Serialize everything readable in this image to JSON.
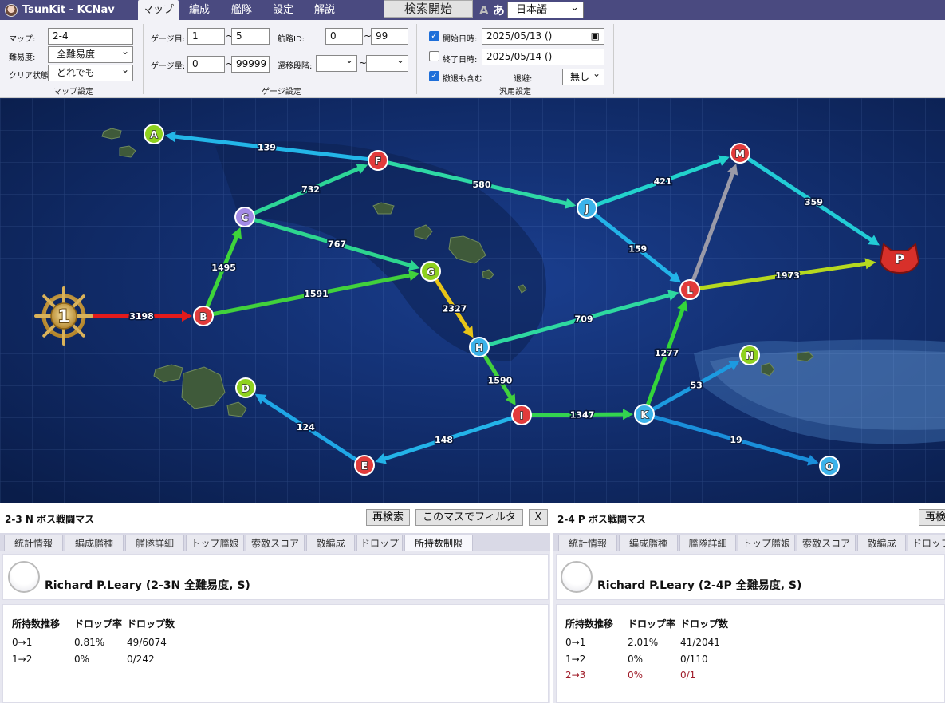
{
  "app": {
    "title": "TsunKit - KCNav"
  },
  "tabs": [
    "マップ",
    "編成",
    "艦隊",
    "設定",
    "解説"
  ],
  "header": {
    "search_button": "検索開始",
    "font_toggle_a": "A",
    "font_toggle_b": "あ",
    "language": "日本語"
  },
  "filters": {
    "map_label": "マップ:",
    "map_value": "2-4",
    "difficulty_label": "難易度:",
    "difficulty_value": "全難易度",
    "clear_label": "クリア状態:",
    "clear_value": "どれでも",
    "map_section": "マップ設定",
    "gauge_no_label": "ゲージ目:",
    "gauge_no_min": "1",
    "gauge_no_max": "5",
    "gauge_amt_label": "ゲージ量:",
    "gauge_amt_min": "0",
    "gauge_amt_max": "99999",
    "route_id_label": "航路ID:",
    "route_id_min": "0",
    "route_id_max": "99",
    "transition_label": "遷移段階:",
    "transition_min": "",
    "transition_max": "",
    "tilde": "~",
    "gauge_section": "ゲージ設定",
    "start_date_label": "開始日時:",
    "start_date_value": "2025/05/13 ()",
    "start_checked": true,
    "end_date_label": "終了日時:",
    "end_date_value": "2025/05/14 ()",
    "end_checked": false,
    "retreat_label": "撤退も含む",
    "retreat_checked": true,
    "evade_label": "退避:",
    "evade_value": "無し",
    "general_section": "汎用設定"
  },
  "map": {
    "nodes": [
      {
        "id": "1",
        "kind": "start"
      },
      {
        "id": "A",
        "color": "green"
      },
      {
        "id": "B",
        "color": "red"
      },
      {
        "id": "C",
        "color": "purple"
      },
      {
        "id": "D",
        "color": "green"
      },
      {
        "id": "E",
        "color": "red"
      },
      {
        "id": "F",
        "color": "red"
      },
      {
        "id": "G",
        "color": "green"
      },
      {
        "id": "H",
        "color": "blue"
      },
      {
        "id": "I",
        "color": "red"
      },
      {
        "id": "J",
        "color": "blue"
      },
      {
        "id": "K",
        "color": "blue"
      },
      {
        "id": "L",
        "color": "red"
      },
      {
        "id": "M",
        "color": "red"
      },
      {
        "id": "N",
        "color": "green"
      },
      {
        "id": "O",
        "color": "blue"
      },
      {
        "id": "P",
        "kind": "boss"
      }
    ],
    "edges": [
      {
        "from": "1",
        "to": "B",
        "count": "3198",
        "color": "#e31b1b"
      },
      {
        "from": "B",
        "to": "C",
        "count": "1495",
        "color": "#3ed43a"
      },
      {
        "from": "B",
        "to": "G",
        "count": "1591",
        "color": "#41d13c"
      },
      {
        "from": "C",
        "to": "F",
        "count": "732",
        "color": "#2dd597"
      },
      {
        "from": "C",
        "to": "G",
        "count": "767",
        "color": "#2dd58f"
      },
      {
        "from": "F",
        "to": "A",
        "count": "139",
        "color": "#23b6e8"
      },
      {
        "from": "F",
        "to": "J",
        "count": "580",
        "color": "#2ed8a5"
      },
      {
        "from": "G",
        "to": "H",
        "count": "2327",
        "color": "#e8c417"
      },
      {
        "from": "H",
        "to": "I",
        "count": "1590",
        "color": "#41d13c"
      },
      {
        "from": "H",
        "to": "L",
        "count": "709",
        "color": "#2ed8a0"
      },
      {
        "from": "I",
        "to": "K",
        "count": "1347",
        "color": "#33d44f"
      },
      {
        "from": "I",
        "to": "E",
        "count": "148",
        "color": "#23b3e8"
      },
      {
        "from": "E",
        "to": "D",
        "count": "124",
        "color": "#1fa7e6"
      },
      {
        "from": "J",
        "to": "M",
        "count": "421",
        "color": "#22d2cc"
      },
      {
        "from": "J",
        "to": "L",
        "count": "159",
        "color": "#23b3e8"
      },
      {
        "from": "K",
        "to": "L",
        "count": "1277",
        "color": "#33d43a"
      },
      {
        "from": "K",
        "to": "N",
        "count": "53",
        "color": "#1c9ae0"
      },
      {
        "from": "K",
        "to": "O",
        "count": "19",
        "color": "#1a8fdb"
      },
      {
        "from": "L",
        "to": "M",
        "count": "",
        "color": "#9a9aa8"
      },
      {
        "from": "L",
        "to": "P",
        "count": "1973",
        "color": "#b6d81f"
      },
      {
        "from": "M",
        "to": "P",
        "count": "359",
        "color": "#22ccd6"
      }
    ]
  },
  "panels": [
    {
      "title": "2-3 N ボス戦闘マス",
      "buttons": [
        "再検索",
        "このマスでフィルタ",
        "X"
      ],
      "tabs": [
        "統計情報",
        "編成艦種",
        "艦隊詳細",
        "トップ艦娘",
        "索敵スコア",
        "敵編成",
        "ドロップ",
        "所持数制限"
      ],
      "active_tab": "所持数制限",
      "ship": "Richard P.Leary (2-3N 全難易度, S)",
      "headers": [
        "所持数推移",
        "ドロップ率",
        "ドロップ数"
      ],
      "rows": [
        [
          "0→1",
          "0.81%",
          "49/6074"
        ],
        [
          "1→2",
          "0%",
          "0/242"
        ]
      ]
    },
    {
      "title": "2-4 P ボス戦闘マス",
      "buttons": [
        "再検索"
      ],
      "tabs": [
        "統計情報",
        "編成艦種",
        "艦隊詳細",
        "トップ艦娘",
        "索敵スコア",
        "敵編成",
        "ドロップ"
      ],
      "active_tab": "",
      "ship": "Richard P.Leary (2-4P 全難易度, S)",
      "headers": [
        "所持数推移",
        "ドロップ率",
        "ドロップ数"
      ],
      "rows": [
        [
          "0→1",
          "2.01%",
          "41/2041"
        ],
        [
          "1→2",
          "0%",
          "0/110"
        ],
        [
          "2→3",
          "0%",
          "0/1"
        ]
      ]
    }
  ]
}
